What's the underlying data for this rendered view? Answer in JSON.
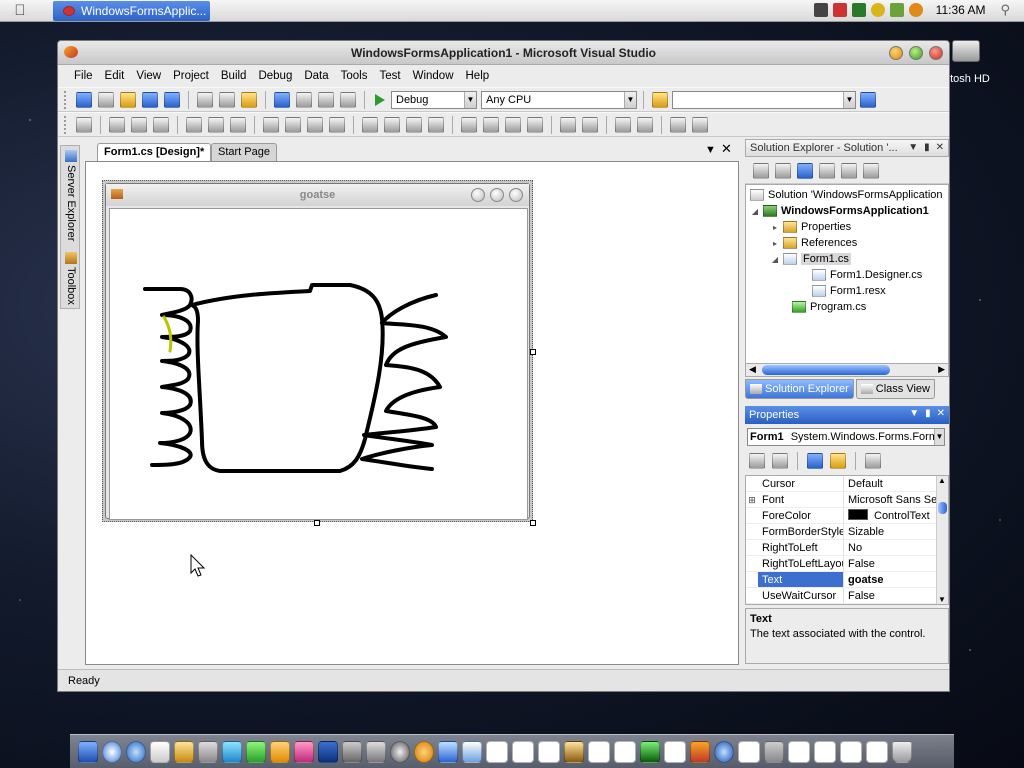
{
  "menubar": {
    "active_app": "WindowsFormsApplic...",
    "clock": "11:36 AM"
  },
  "desktop": {
    "hd_label": "ntosh HD"
  },
  "window": {
    "title": "WindowsFormsApplication1 - Microsoft Visual Studio",
    "menu": [
      "File",
      "Edit",
      "View",
      "Project",
      "Build",
      "Debug",
      "Data",
      "Tools",
      "Test",
      "Window",
      "Help"
    ],
    "config": "Debug",
    "platform": "Any CPU"
  },
  "sidestrip": {
    "server_explorer": "Server Explorer",
    "toolbox": "Toolbox"
  },
  "doc": {
    "tabs": [
      "Form1.cs [Design]*",
      "Start Page"
    ],
    "form_title": "goatse"
  },
  "solution_explorer": {
    "title": "Solution Explorer - Solution '...",
    "items": [
      "Solution 'WindowsFormsApplication",
      "WindowsFormsApplication1",
      "Properties",
      "References",
      "Form1.cs",
      "Form1.Designer.cs",
      "Form1.resx",
      "Program.cs"
    ],
    "tabs": [
      "Solution Explorer",
      "Class View"
    ]
  },
  "properties": {
    "title": "Properties",
    "object_name": "Form1",
    "object_type": "System.Windows.Forms.Form",
    "rows": [
      {
        "name": "Cursor",
        "value": "Default"
      },
      {
        "name": "Font",
        "value": "Microsoft Sans Se"
      },
      {
        "name": "ForeColor",
        "value": "ControlText"
      },
      {
        "name": "FormBorderStyle",
        "value": "Sizable"
      },
      {
        "name": "RightToLeft",
        "value": "No"
      },
      {
        "name": "RightToLeftLayout",
        "value": "False"
      },
      {
        "name": "Text",
        "value": "goatse"
      },
      {
        "name": "UseWaitCursor",
        "value": "False"
      }
    ],
    "description_title": "Text",
    "description": "The text associated with the control."
  },
  "status": "Ready",
  "colors": {
    "accent": "#3d6fd1",
    "forecolor_swatch": "#000000",
    "drawing_stroke": "#000000",
    "drawing_highlight": "#b8c400"
  }
}
